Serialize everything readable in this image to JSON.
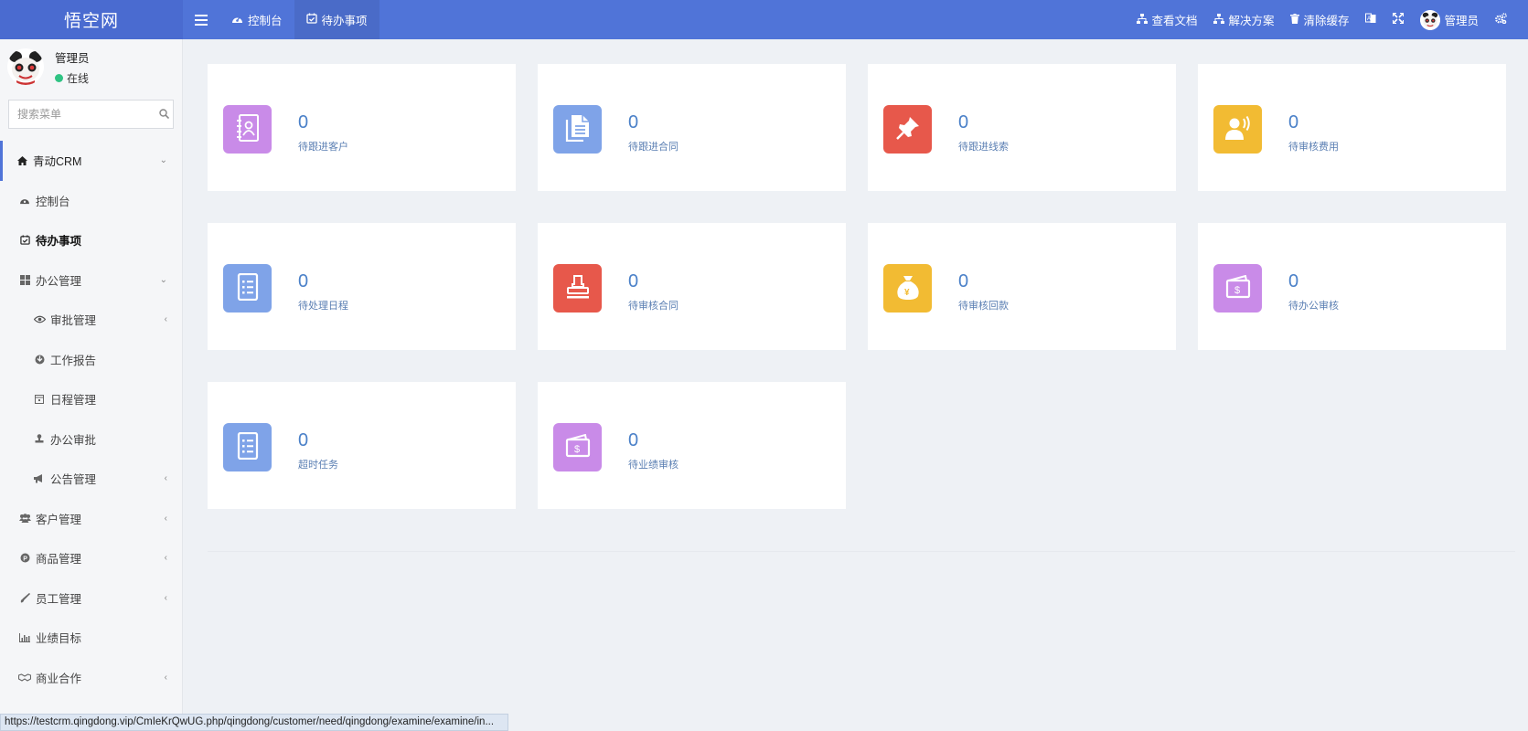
{
  "app": {
    "title": "悟空网"
  },
  "topnav": [
    {
      "label": "控制台",
      "icon": "dashboard-icon"
    },
    {
      "label": "待办事项",
      "icon": "calendar-check-icon",
      "active": true
    }
  ],
  "topright": [
    {
      "label": "查看文档",
      "icon": "sitemap-icon"
    },
    {
      "label": "解决方案",
      "icon": "sitemap-icon"
    },
    {
      "label": "清除缓存",
      "icon": "trash-icon"
    }
  ],
  "user": {
    "name": "管理员",
    "status": "在线"
  },
  "search": {
    "placeholder": "搜索菜单"
  },
  "menu": [
    {
      "label": "青动CRM",
      "icon": "home-icon",
      "chev": "⌄"
    },
    {
      "label": "控制台",
      "icon": "dashboard-icon",
      "chev": ""
    },
    {
      "label": "待办事项",
      "icon": "calendar-check-icon",
      "chev": ""
    },
    {
      "label": "办公管理",
      "icon": "windows-icon",
      "chev": "⌄"
    },
    {
      "label": "审批管理",
      "icon": "eye-icon",
      "chev": "‹"
    },
    {
      "label": "工作报告",
      "icon": "report-icon",
      "chev": ""
    },
    {
      "label": "日程管理",
      "icon": "calendar-icon",
      "chev": ""
    },
    {
      "label": "办公审批",
      "icon": "stamp-icon",
      "chev": ""
    },
    {
      "label": "公告管理",
      "icon": "bullhorn-icon",
      "chev": "‹"
    },
    {
      "label": "客户管理",
      "icon": "users-icon",
      "chev": "‹"
    },
    {
      "label": "商品管理",
      "icon": "product-icon",
      "chev": "‹"
    },
    {
      "label": "员工管理",
      "icon": "brush-icon",
      "chev": "‹"
    },
    {
      "label": "业绩目标",
      "icon": "bar-chart-icon",
      "chev": ""
    },
    {
      "label": "商业合作",
      "icon": "handshake-icon",
      "chev": "‹"
    }
  ],
  "cards": [
    {
      "count": "0",
      "label": "待跟进客户",
      "icon": "contact-book-icon",
      "color": "#c98be8"
    },
    {
      "count": "0",
      "label": "待跟进合同",
      "icon": "document-icon",
      "color": "#7fa3e8"
    },
    {
      "count": "0",
      "label": "待跟进线索",
      "icon": "pin-icon",
      "color": "#e7584b"
    },
    {
      "count": "0",
      "label": "待审核费用",
      "icon": "user-voice-icon",
      "color": "#f2bb33"
    },
    {
      "count": "0",
      "label": "待处理日程",
      "icon": "list-icon",
      "color": "#7fa3e8"
    },
    {
      "count": "0",
      "label": "待审核合同",
      "icon": "stamp-icon",
      "color": "#e7584b"
    },
    {
      "count": "0",
      "label": "待审核回款",
      "icon": "money-bag-icon",
      "color": "#f2bb33"
    },
    {
      "count": "0",
      "label": "待办公审核",
      "icon": "wallet-icon",
      "color": "#c98be8"
    },
    {
      "count": "0",
      "label": "超时任务",
      "icon": "list-icon",
      "color": "#7fa3e8"
    },
    {
      "count": "0",
      "label": "待业绩审核",
      "icon": "wallet-icon",
      "color": "#c98be8"
    }
  ],
  "statusbar": {
    "url": "https://testcrm.qingdong.vip/CmIeKrQwUG.php/qingdong/customer/need/qingdong/examine/examine/in..."
  }
}
